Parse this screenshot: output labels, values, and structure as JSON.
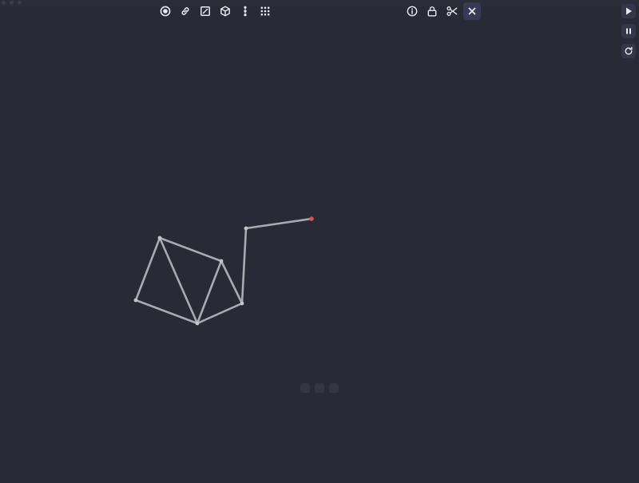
{
  "window": {
    "title": "",
    "traffic_lights": [
      "close",
      "minimize",
      "zoom"
    ]
  },
  "toolbar_left": {
    "items": [
      {
        "name": "circle-tool",
        "icon": "record-circle-icon"
      },
      {
        "name": "link-tool",
        "icon": "link-icon"
      },
      {
        "name": "square-tool",
        "icon": "square-slash-icon"
      },
      {
        "name": "cube-tool",
        "icon": "cube-icon"
      },
      {
        "name": "chain-tool",
        "icon": "vertical-dots-icon"
      },
      {
        "name": "grid-tool",
        "icon": "grid-dots-icon"
      }
    ]
  },
  "toolbar_right": {
    "items": [
      {
        "name": "info-tool",
        "icon": "info-icon"
      },
      {
        "name": "lock-tool",
        "icon": "lock-icon"
      },
      {
        "name": "cut-tool",
        "icon": "scissors-icon"
      },
      {
        "name": "delete-tool",
        "icon": "close-icon",
        "active": true
      }
    ]
  },
  "side_controls": {
    "items": [
      {
        "name": "play-button",
        "icon": "play-icon"
      },
      {
        "name": "pause-button",
        "icon": "pause-icon"
      },
      {
        "name": "reset-button",
        "icon": "refresh-icon"
      }
    ]
  },
  "simulation": {
    "colors": {
      "background": "#282a35",
      "rod": "#a9aab0",
      "joint": "#c4c5ca",
      "selected_joint": "#d9534f",
      "icon": "#e8e9ee"
    },
    "nodes": [
      {
        "id": "n1",
        "selected": false
      },
      {
        "id": "n2",
        "selected": false
      },
      {
        "id": "n3",
        "selected": false
      },
      {
        "id": "n4",
        "selected": false
      },
      {
        "id": "n5",
        "selected": false
      },
      {
        "id": "n6",
        "selected": false
      },
      {
        "id": "n7",
        "selected": true
      }
    ],
    "edges": [
      [
        "n1",
        "n2"
      ],
      [
        "n1",
        "n3"
      ],
      [
        "n2",
        "n3"
      ],
      [
        "n2",
        "n4"
      ],
      [
        "n3",
        "n4"
      ],
      [
        "n3",
        "n5"
      ],
      [
        "n4",
        "n5"
      ],
      [
        "n5",
        "n6"
      ],
      [
        "n6",
        "n7"
      ]
    ]
  }
}
